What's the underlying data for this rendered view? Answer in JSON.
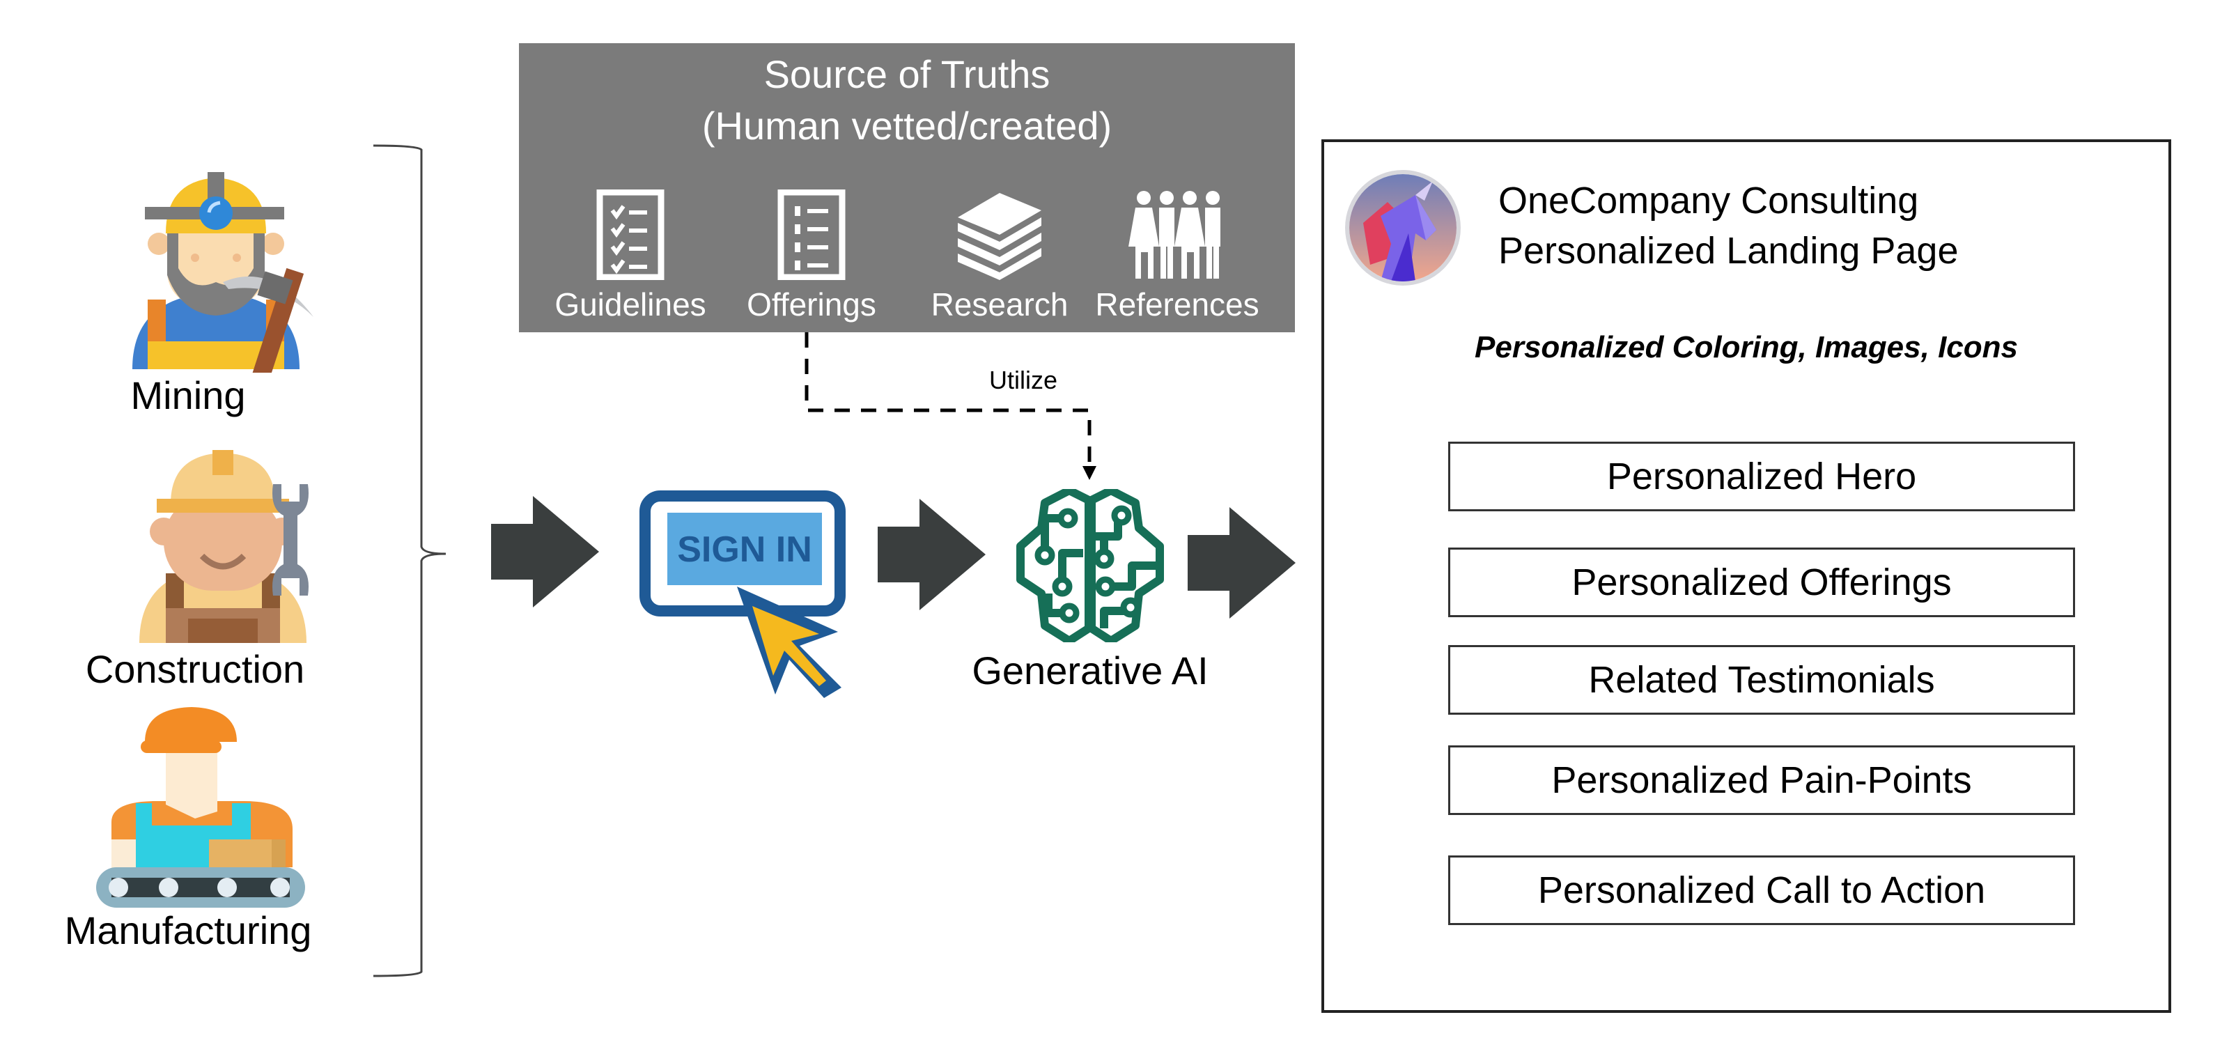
{
  "industries": [
    {
      "label": "Mining",
      "icon": "miner-icon"
    },
    {
      "label": "Construction",
      "icon": "construction-worker-icon"
    },
    {
      "label": "Manufacturing",
      "icon": "factory-worker-icon"
    }
  ],
  "source_of_truths": {
    "title_line1": "Source of Truths",
    "title_line2": "(Human vetted/created)",
    "items": [
      {
        "label": "Guidelines",
        "icon": "checklist-icon"
      },
      {
        "label": "Offerings",
        "icon": "list-icon"
      },
      {
        "label": "Research",
        "icon": "books-icon"
      },
      {
        "label": "References",
        "icon": "people-icon"
      }
    ],
    "connector_label": "Utilize"
  },
  "sign_in": {
    "button_text": "SIGN IN",
    "icon": "sign-in-click-icon"
  },
  "generative_ai": {
    "label": "Generative AI",
    "icon": "ai-brain-icon"
  },
  "landing_page": {
    "title_line1": "OneCompany Consulting",
    "title_line2": "Personalized Landing Page",
    "subtitle": "Personalized Coloring, Images, Icons",
    "sections": [
      "Personalized Hero",
      "Personalized Offerings",
      "Related Testimonials",
      "Personalized Pain-Points",
      "Personalized Call to Action"
    ]
  },
  "colors": {
    "sot_bg": "#7b7b7b",
    "arrow": "#3a3e3e",
    "signin_blue": "#1f5a96",
    "signin_light": "#5aa9e0",
    "cursor_yellow": "#f5b91e",
    "ai_green": "#166f57"
  }
}
